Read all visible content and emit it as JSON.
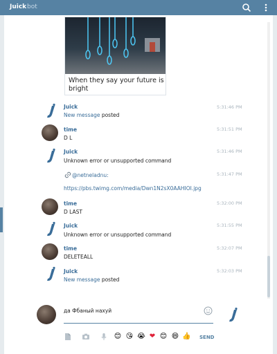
{
  "titlebar": {
    "name": "Juick",
    "subtitle": "bot",
    "search_icon": "search-icon",
    "menu_icon": "more-vert-icon"
  },
  "media": {
    "caption": "When they say your future is bright"
  },
  "messages": [
    {
      "author": "Juick",
      "link": "New message",
      "text": " posted",
      "time": "5:31:46 PM",
      "avatar": "juick-logo"
    },
    {
      "author": "time",
      "text": "D L",
      "time": "5:31:51 PM",
      "avatar": "user-photo"
    },
    {
      "author": "Juick",
      "text": "Unknown error or unsupported command",
      "time": "5:31:46 PM",
      "avatar": "juick-logo"
    },
    {
      "author": "",
      "mention": "@netneladnu:",
      "time": "5:31:47 PM",
      "url": "https://pbs.twimg.com/media/Dwn1N2sX0AAHIOI.jpg"
    },
    {
      "author": "time",
      "text": "D LAST",
      "time": "5:32:00 PM",
      "avatar": "user-photo"
    },
    {
      "author": "Juick",
      "text": "Unknown error or unsupported command",
      "time": "5:31:55 PM",
      "avatar": "juick-logo"
    },
    {
      "author": "time",
      "text": "DELETEALL",
      "time": "5:32:07 PM",
      "avatar": "user-photo"
    },
    {
      "author": "Juick",
      "link": "New message",
      "text": " posted",
      "time": "5:32:03 PM",
      "avatar": "juick-logo"
    }
  ],
  "compose": {
    "value": "да Фбаный нахуй",
    "send_label": "SEND",
    "emojis": [
      "😊",
      "😘",
      "😭",
      "❤",
      "😊",
      "😄",
      "👍"
    ]
  }
}
